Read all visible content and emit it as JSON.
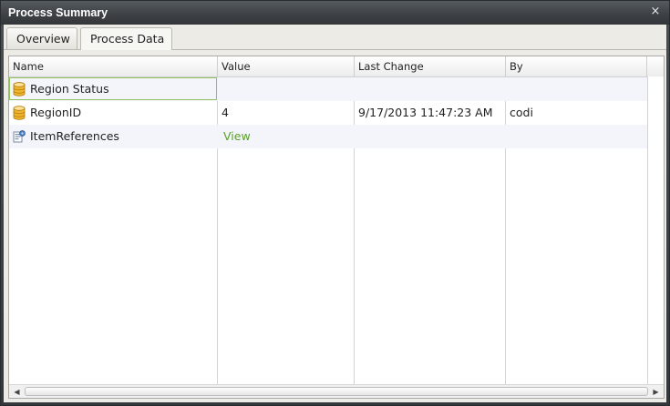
{
  "window": {
    "title": "Process Summary",
    "close_glyph": "×"
  },
  "tabs": [
    {
      "label": "Overview",
      "active": false
    },
    {
      "label": "Process Data",
      "active": true
    }
  ],
  "grid": {
    "columns": [
      "Name",
      "Value",
      "Last Change",
      "By"
    ],
    "rows": [
      {
        "icon": "database-icon",
        "name": "Region Status",
        "value": "",
        "last_change": "",
        "by": "",
        "selected": true
      },
      {
        "icon": "database-icon",
        "name": "RegionID",
        "value": "4",
        "last_change": "9/17/2013 11:47:23 AM",
        "by": "codi"
      },
      {
        "icon": "item-references-icon",
        "name": "ItemReferences",
        "value": "View",
        "last_change": "",
        "by": ""
      }
    ]
  },
  "colors": {
    "selection_border": "#8fc45a",
    "link": "#5a9d2a",
    "alt_row": "#f4f5fa"
  }
}
